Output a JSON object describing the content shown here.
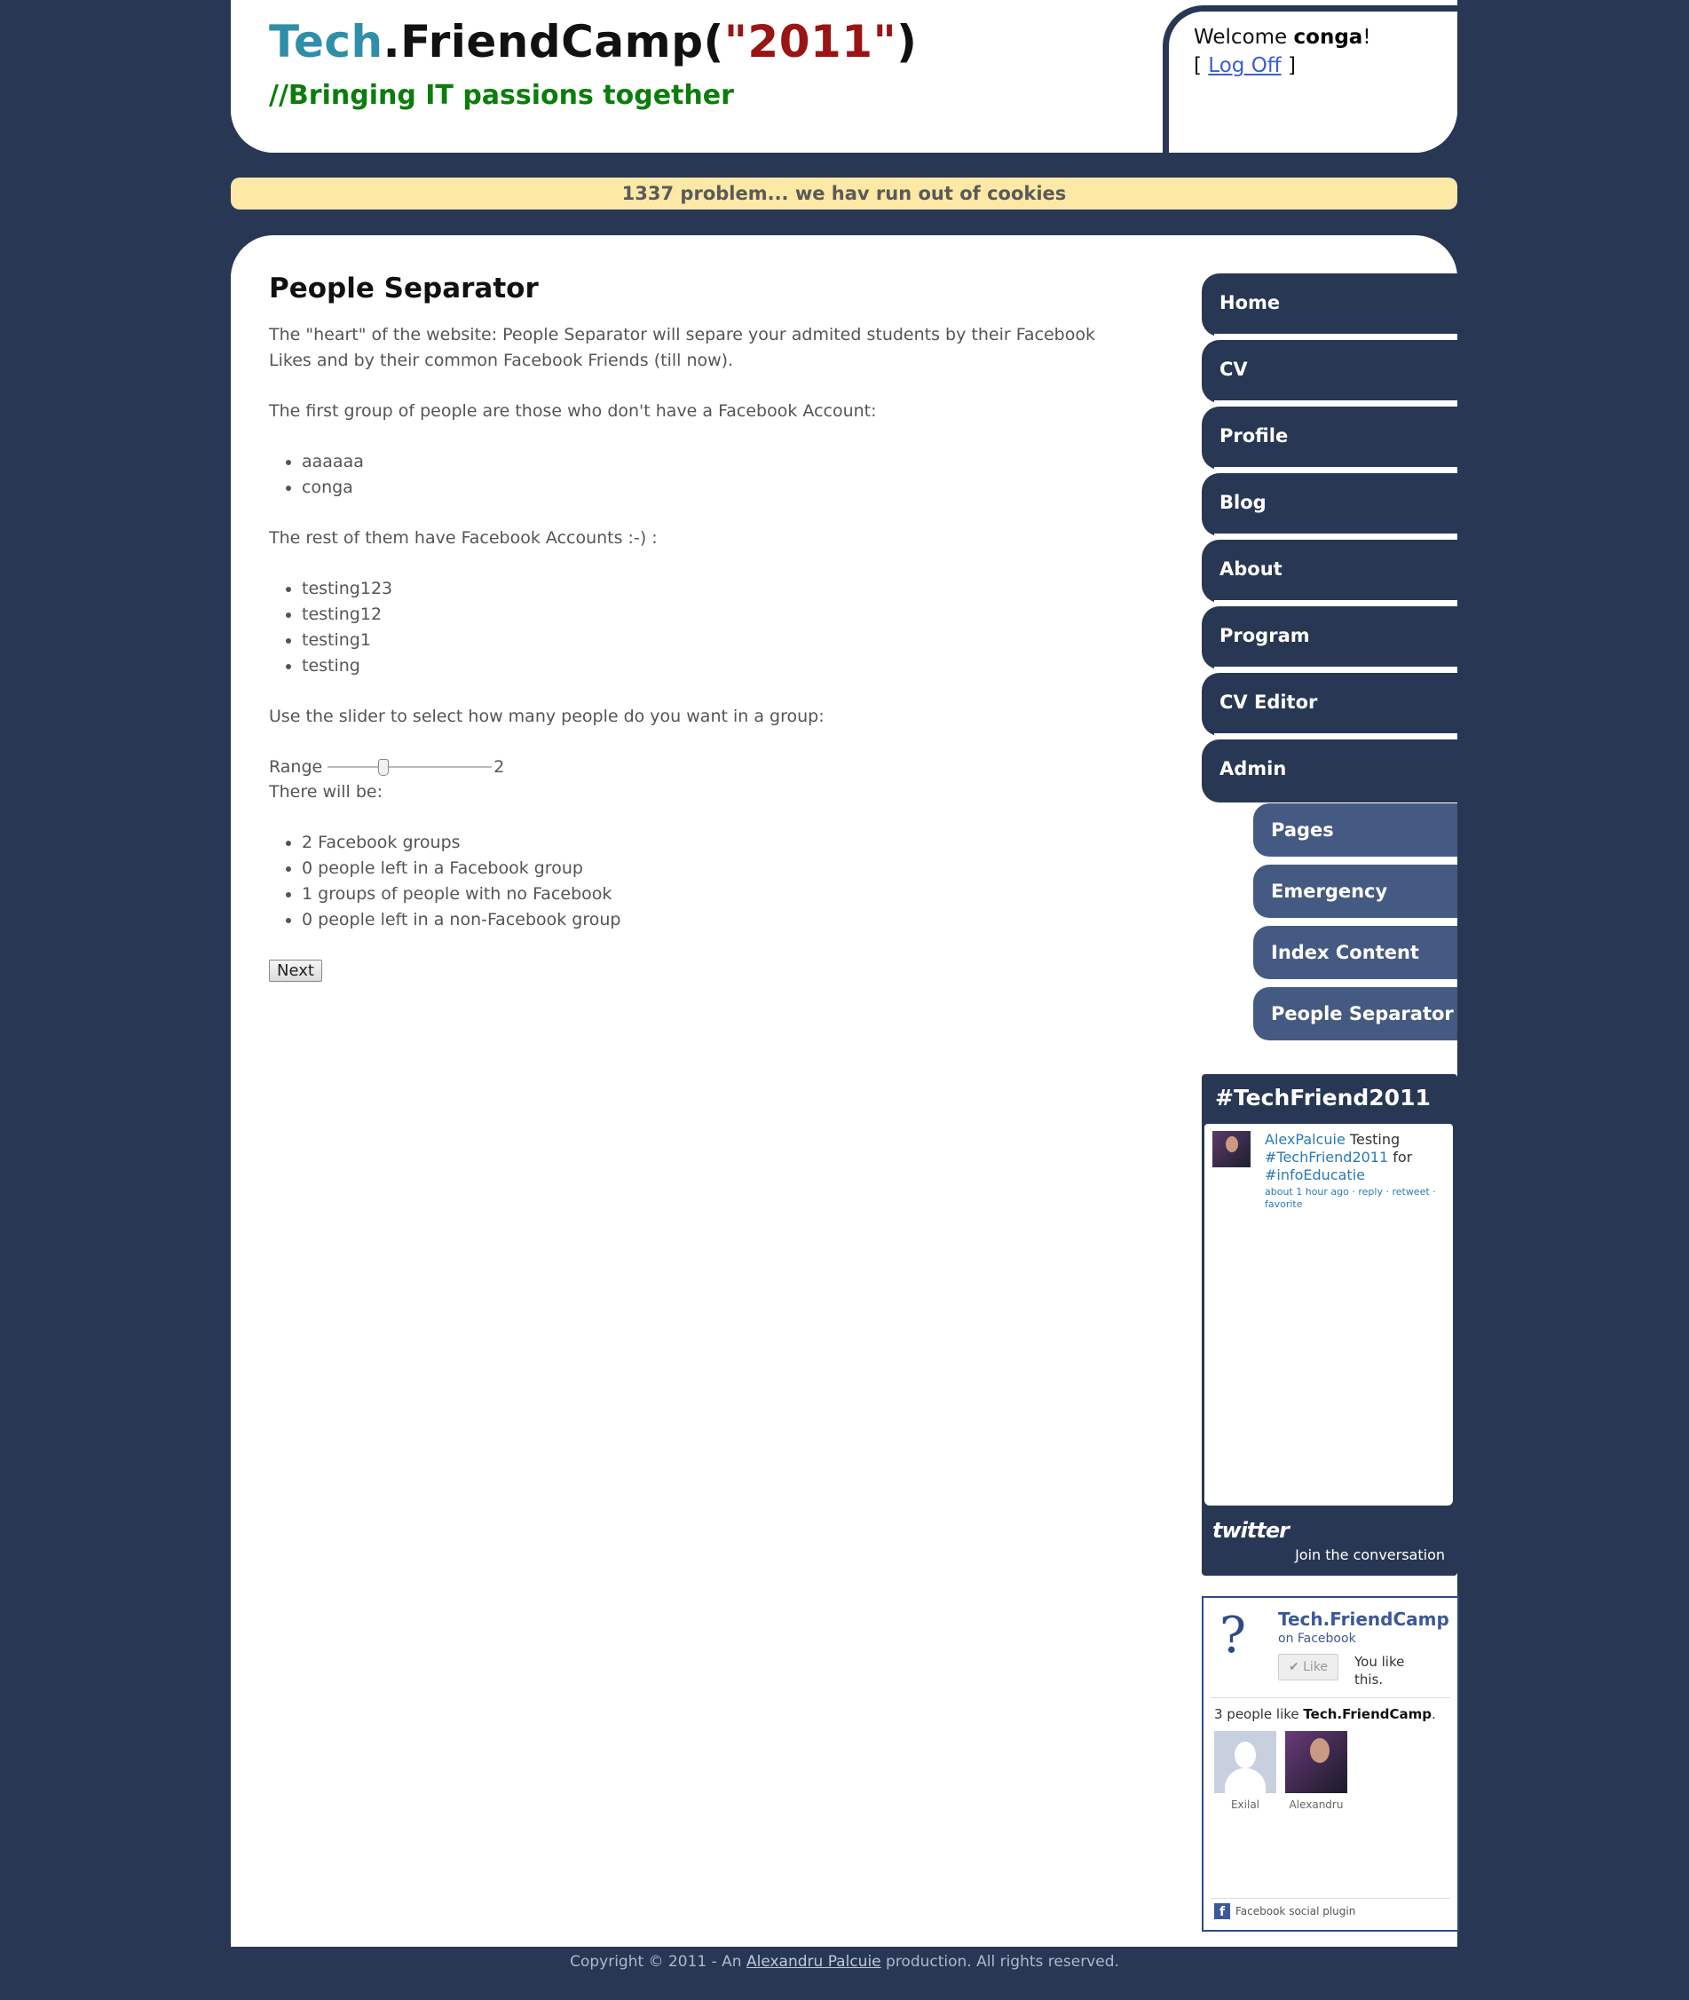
{
  "header": {
    "logo_tech": "Tech",
    "logo_rest": ".FriendCamp(",
    "logo_year": "\"2011\"",
    "logo_close": ")",
    "tagline": "//Bringing IT passions together",
    "welcome_prefix": "Welcome ",
    "username": "conga",
    "welcome_suffix": "!",
    "bracket_open": "[",
    "logoff_label": "Log Off",
    "bracket_close": "]"
  },
  "notice": "1337 problem... we hav run out of cookies",
  "main": {
    "title": "People Separator",
    "intro": "The \"heart\" of the website: People Separator will separe your admited students by their Facebook Likes and by their common Facebook Friends (till now).",
    "no_fb_intro": "The first group of people are those who don't have a Facebook Account:",
    "no_fb_people": [
      "aaaaaa",
      "conga"
    ],
    "fb_intro": "The rest of them have Facebook Accounts :-) :",
    "fb_people": [
      "testing123",
      "testing12",
      "testing1",
      "testing"
    ],
    "slider_intro": "Use the slider to select how many people do you want in a group:",
    "range_label": "Range",
    "range_value": "2",
    "range_fraction": 0.33,
    "there_will_be": "There will be:",
    "results": [
      "2 Facebook groups",
      "0 people left in a Facebook group",
      "1 groups of people with no Facebook",
      "0 people left in a non-Facebook group"
    ],
    "next_label": "Next"
  },
  "nav": {
    "items": [
      "Home",
      "CV",
      "Profile",
      "Blog",
      "About",
      "Program",
      "CV Editor",
      "Admin"
    ],
    "subitems": [
      "Pages",
      "Emergency",
      "Index Content",
      "People Separator"
    ]
  },
  "twitter": {
    "title": "#TechFriend2011",
    "tweet_user": "AlexPalcuie",
    "tweet_text1": " Testing ",
    "tweet_tag1": "#TechFriend2011",
    "tweet_text2": " for ",
    "tweet_tag2": "#infoEducatie",
    "tweet_meta": "about 1 hour ago · reply · retweet · favorite",
    "logo": "twitter",
    "join": "Join the conversation"
  },
  "facebook": {
    "page_name": "Tech.FriendCamp",
    "on_facebook": "on Facebook",
    "like_label": "✔ Like",
    "you_like": "You like this.",
    "count_prefix": "3 people like ",
    "count_name": "Tech.FriendCamp",
    "count_suffix": ".",
    "person1": "Exilal",
    "person2": "Alexandru",
    "plugin": "Facebook social plugin"
  },
  "footer": {
    "prefix": "Copyright © 2011 - An ",
    "author": "Alexandru Palcuie",
    "suffix": " production. All rights reserved."
  },
  "colors": {
    "background": "#283754",
    "logo_tech": "#2f8ea8",
    "logo_year": "#9b1414",
    "tagline": "#0b7d0b",
    "notice_bg": "#fde8a6",
    "nav_bg": "#283754",
    "subnav_bg": "#455a82"
  }
}
